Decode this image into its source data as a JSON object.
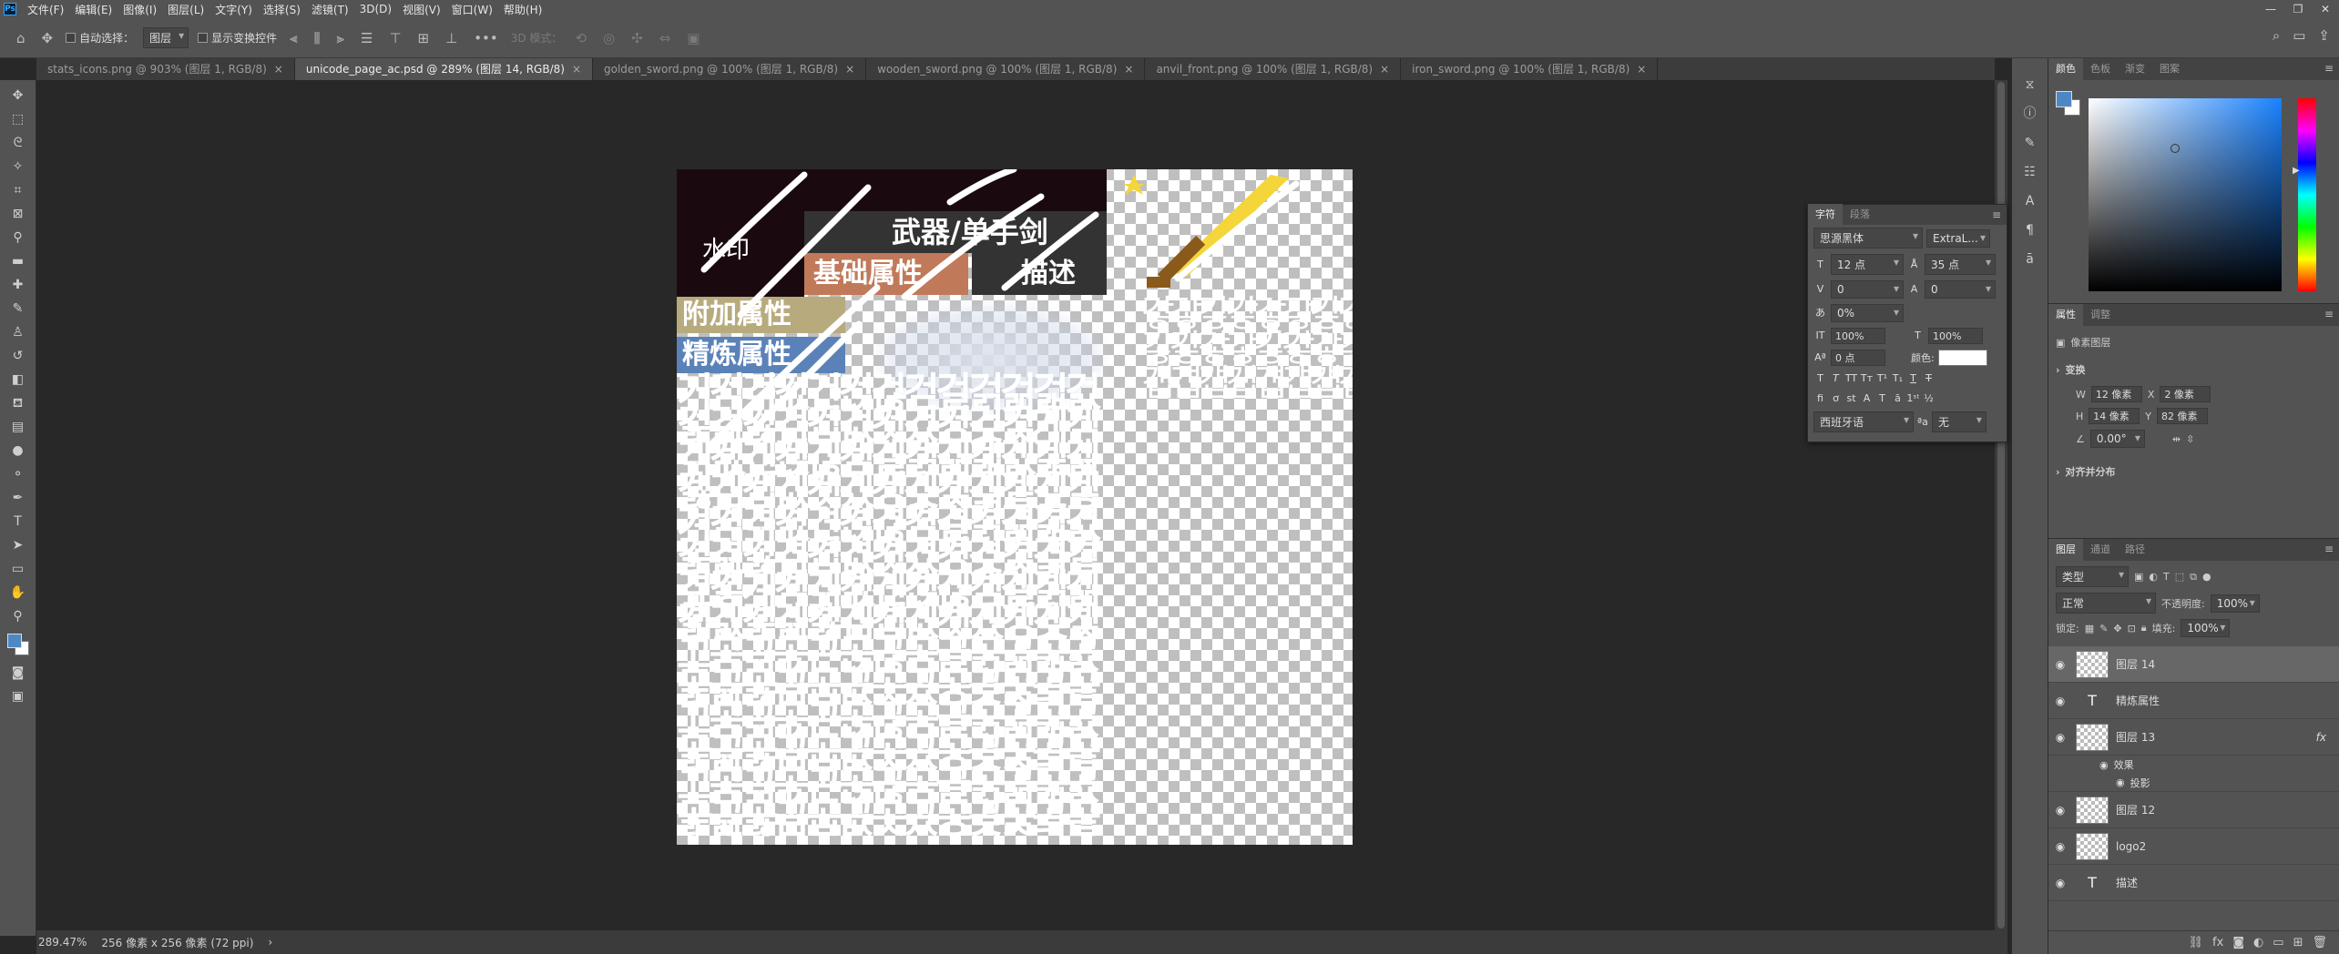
{
  "app": {
    "logo": "Ps"
  },
  "menu": [
    "文件(F)",
    "编辑(E)",
    "图像(I)",
    "图层(L)",
    "文字(Y)",
    "选择(S)",
    "滤镜(T)",
    "3D(D)",
    "视图(V)",
    "窗口(W)",
    "帮助(H)"
  ],
  "window_controls": [
    "—",
    "❐",
    "✕"
  ],
  "options": {
    "auto_select_label": "自动选择：",
    "auto_select_target": "图层",
    "show_transform_label": "显示变换控件",
    "mode3d_label": "3D 模式："
  },
  "tabs": [
    {
      "label": "stats_icons.png @ 903% (图层 1, RGB/8)",
      "active": false
    },
    {
      "label": "unicode_page_ac.psd @ 289% (图层 14, RGB/8)",
      "active": true
    },
    {
      "label": "golden_sword.png @ 100% (图层 1, RGB/8)",
      "active": false
    },
    {
      "label": "wooden_sword.png @ 100% (图层 1, RGB/8)",
      "active": false
    },
    {
      "label": "anvil_front.png @ 100% (图层 1, RGB/8)",
      "active": false
    },
    {
      "label": "iron_sword.png @ 100% (图层 1, RGB/8)",
      "active": false
    }
  ],
  "tab_close": "×",
  "canvas": {
    "watermark": "水印",
    "labels": {
      "weapon": "武器/单手剑",
      "base_attr": "基础属性",
      "desc": "描述",
      "extra_attr": "附加属性",
      "refine_attr": "精炼属性"
    },
    "glyph_rows": [
      "갛갛갛갛갛갛갛갛갛갛갛갛갛",
      "갛갛갛갛갛갛갛갛갛갛갛갛갛",
      "걥걥걥걥걥걥걥걥걥걥걥걥걥",
      "걥걥걥걥걥걥걥걥걥걥걥걥걥",
      "거걱걲걳건걵걶걷걸걹걺걻걼",
      "걽걾걿검겁겂것겄겅겆겇게겍",
      "겎겏겐겑겒겓겔겕겖겗겘겙겚",
      "겛겜겝겞겟겠겡겢겣겤겥겦겧",
      "겨격겪겫견겭겮겯결겱겲겳겴",
      "겵겶겷겸겹겺겻겼경겾겿곀곁",
      "곂곃계곅곆곇곈곉곊곋곌곍곎",
      "곏곐곑곒곓곔곕곖곗곘곙곚곛",
      "고곡곢곣곤곥곦곧골곩곪곫곬",
      "곭곮곯곰곱곲곳곴공곶곷곸곹"
    ],
    "colors": {
      "watermark_bg": "#1a0a10",
      "base_attr_bg": "#c07a5a",
      "extra_attr_bg": "#b7ab7e",
      "refine_attr_bg": "#5b82b8",
      "stroke": "#ffffff",
      "sword": "#f4d63a"
    }
  },
  "status": {
    "zoom": "289.47%",
    "doc_size": "256 像素 x 256 像素 (72 ppi)",
    "arrow": "›"
  },
  "color_panel": {
    "tabs": [
      "颜色",
      "色板",
      "渐变",
      "图案"
    ],
    "fg": "#4d88c4",
    "bg": "#ffffff"
  },
  "properties": {
    "tabs": [
      "属性",
      "调整"
    ],
    "kind": "像素图层",
    "transform_label": "变换",
    "w_label": "W",
    "w": "12 像素",
    "h_label": "H",
    "h": "14 像素",
    "x_label": "X",
    "x": "2 像素",
    "y_label": "Y",
    "y": "82 像素",
    "angle": "0.00°",
    "align_label": "对齐并分布"
  },
  "layers_panel": {
    "tabs": [
      "图层",
      "通道",
      "路径"
    ],
    "filter": "类型",
    "blend": "正常",
    "opacity_label": "不透明度:",
    "opacity": "100%",
    "lock_label": "锁定:",
    "fill_label": "填充:",
    "fill": "100%",
    "layers": [
      {
        "name": "图层 14",
        "type": "pixel",
        "selected": true
      },
      {
        "name": "精炼属性",
        "type": "text",
        "selected": false
      },
      {
        "name": "图层 13",
        "type": "pixel",
        "selected": false,
        "fx": "fx"
      },
      {
        "name": "图层 12",
        "type": "pixel",
        "selected": false
      },
      {
        "name": "logo2",
        "type": "pixel",
        "selected": false
      },
      {
        "name": "描述",
        "type": "text",
        "selected": false
      }
    ],
    "effects_label": "效果",
    "shadow_label": "投影"
  },
  "char_panel": {
    "tabs": [
      "字符",
      "段落"
    ],
    "font": "思源黑体",
    "style": "ExtraL...",
    "size": "12 点",
    "leading": "35 点",
    "kerning": "0",
    "tracking": "0",
    "scale_pct": "0%",
    "vscale": "100%",
    "hscale": "100%",
    "baseline": "0 点",
    "color_label": "颜色:",
    "language": "西班牙语",
    "aa_label": "ªa",
    "aa": "无"
  }
}
